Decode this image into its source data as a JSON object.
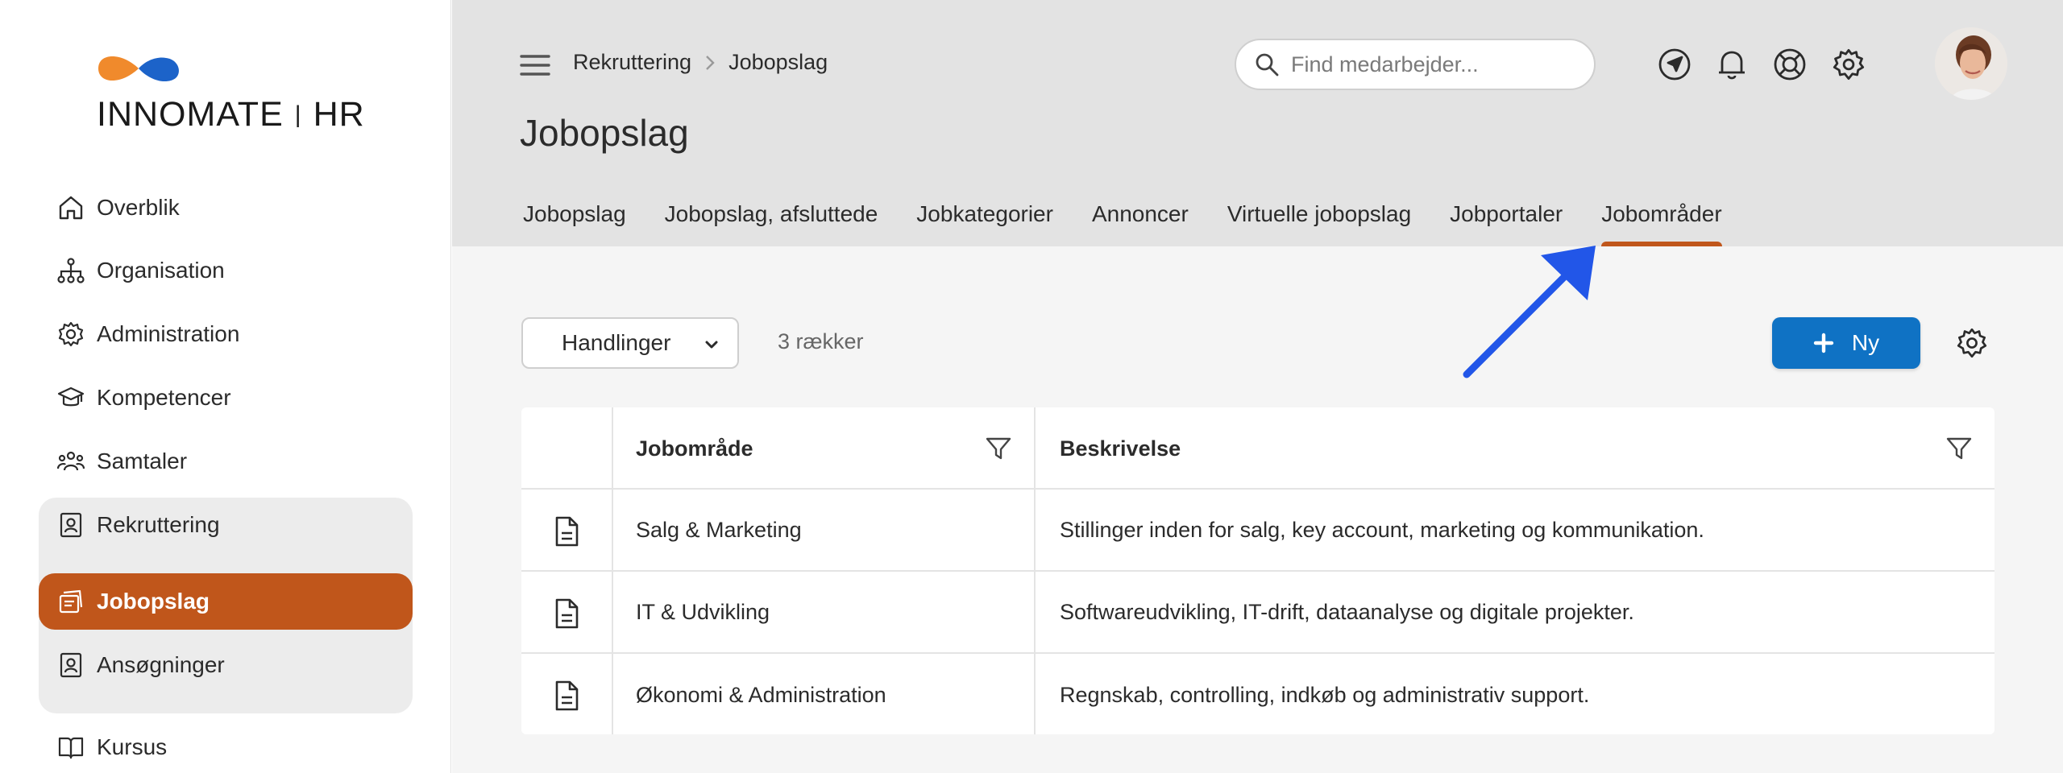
{
  "brand": {
    "name_left": "INNOMATE",
    "name_right": "HR",
    "colors": {
      "orange": "#f08a2c",
      "blue": "#1c63c9"
    }
  },
  "sidebar": {
    "items": [
      {
        "label": "Overblik",
        "icon": "home-icon"
      },
      {
        "label": "Organisation",
        "icon": "org-chart-icon"
      },
      {
        "label": "Administration",
        "icon": "gear-icon"
      },
      {
        "label": "Kompetencer",
        "icon": "graduation-cap-icon"
      },
      {
        "label": "Samtaler",
        "icon": "people-icon"
      },
      {
        "label": "Rekruttering",
        "icon": "badge-icon"
      },
      {
        "label": "Jobopslag",
        "icon": "job-post-icon"
      },
      {
        "label": "Ansøgninger",
        "icon": "badge-icon"
      },
      {
        "label": "Kursus",
        "icon": "book-icon"
      }
    ],
    "active_color": "#c0561b"
  },
  "header": {
    "breadcrumb": [
      "Rekruttering",
      "Jobopslag"
    ],
    "search_placeholder": "Find medarbejder...",
    "title": "Jobopslag",
    "icons": [
      "navigation-icon",
      "bell-icon",
      "lifebuoy-icon",
      "gear-icon"
    ]
  },
  "tabs": [
    {
      "label": "Jobopslag"
    },
    {
      "label": "Jobopslag, afsluttede"
    },
    {
      "label": "Jobkategorier"
    },
    {
      "label": "Annoncer"
    },
    {
      "label": "Virtuelle jobopslag"
    },
    {
      "label": "Jobportaler"
    },
    {
      "label": "Jobområder",
      "active": true
    }
  ],
  "toolbar": {
    "actions_label": "Handlinger",
    "row_count": "3 rækker",
    "new_label": "Ny",
    "accent": "#0f72c4"
  },
  "table": {
    "columns": [
      "Jobområde",
      "Beskrivelse"
    ],
    "rows": [
      {
        "area": "Salg & Marketing",
        "description": "Stillinger inden for salg, key account, marketing og kommunikation."
      },
      {
        "area": "IT & Udvikling",
        "description": "Softwareudvikling, IT-drift, dataanalyse og digitale projekter."
      },
      {
        "area": "Økonomi & Administration",
        "description": "Regnskab, controlling, indkøb og administrativ support."
      }
    ]
  },
  "annotation": {
    "arrow_color": "#2256e8"
  }
}
